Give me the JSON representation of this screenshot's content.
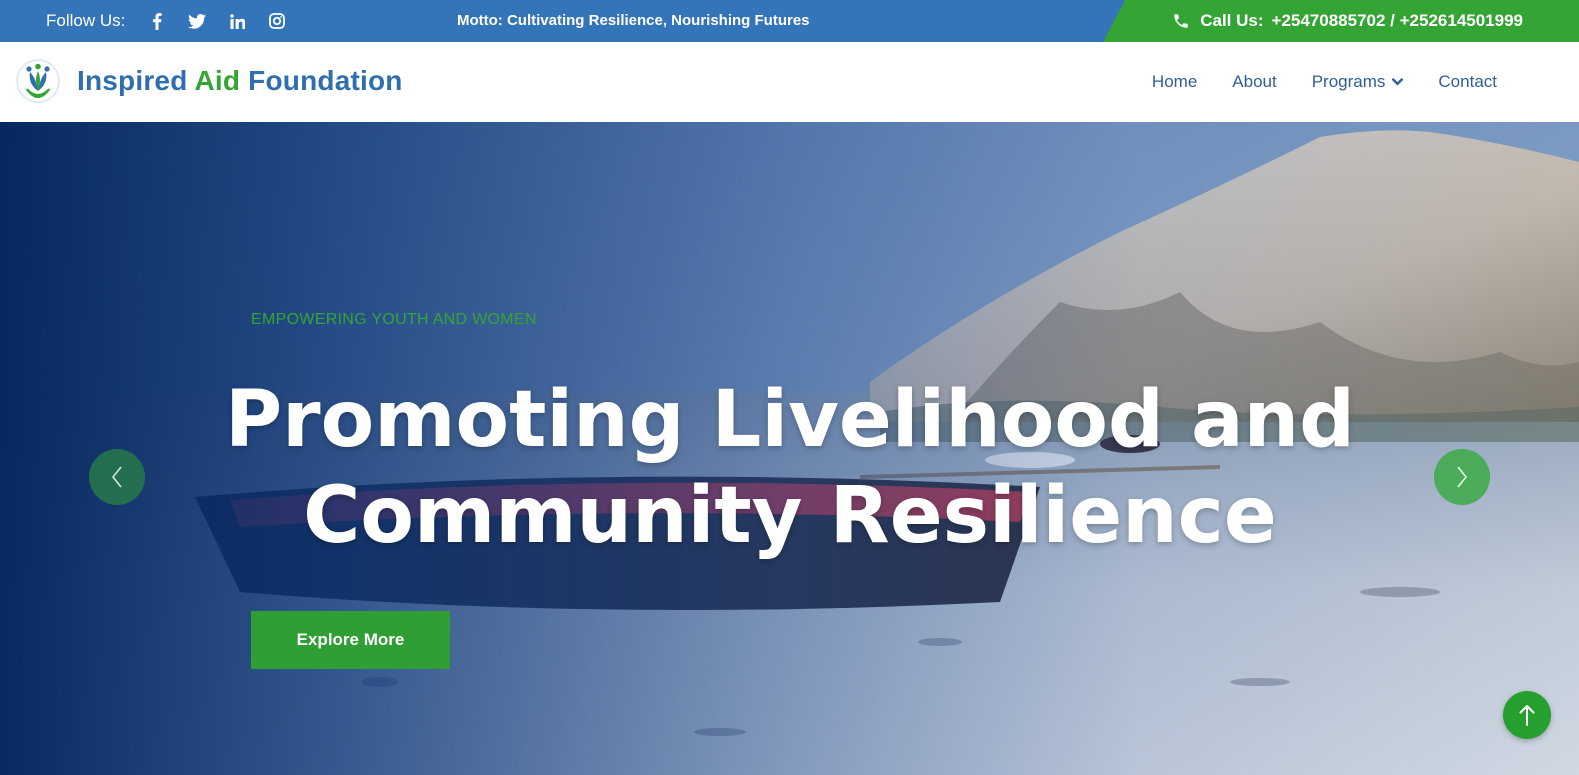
{
  "topbar": {
    "follow_label": "Follow Us:",
    "social": [
      "facebook-icon",
      "twitter-icon",
      "linkedin-icon",
      "instagram-icon"
    ],
    "motto": "Motto: Cultivating Resilience, Nourishing Futures",
    "call_label": "Call Us:",
    "phones": "+25470885702 / +252614501999"
  },
  "brand": {
    "part1": "Inspired",
    "part2": "Aid",
    "part3": "Foundation"
  },
  "nav": {
    "items": [
      "Home",
      "About",
      "Programs",
      "Contact"
    ]
  },
  "hero": {
    "eyebrow": "EMPOWERING YOUTH AND WOMEN",
    "title_line1": "Promoting Livelihood and",
    "title_line2": "Community Resilience",
    "cta": "Explore More"
  },
  "colors": {
    "topbar_blue": "#3474b8",
    "accent_green": "#34a534",
    "brand_blue": "#2f6fb0",
    "nav_text": "#2f5f93"
  }
}
